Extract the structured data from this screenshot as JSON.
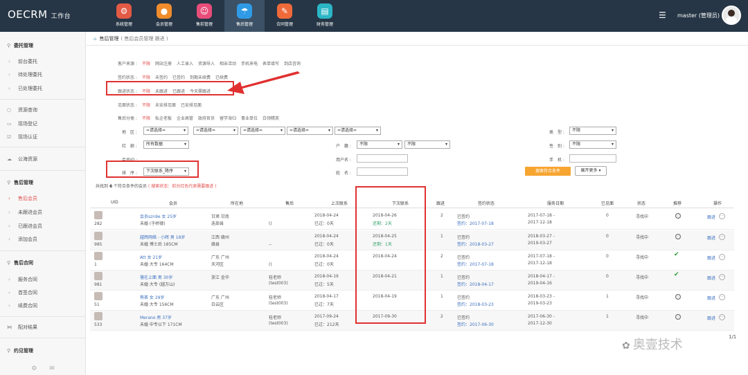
{
  "app": {
    "logo": "OECRM",
    "logo_sub": "工作台",
    "user": "master (管理员)",
    "menu_icon": "hamburger-icon"
  },
  "modules": [
    {
      "label": "系统管理",
      "icon": "gear-icon",
      "color": "#e35a45"
    },
    {
      "label": "会员管理",
      "icon": "user-icon",
      "color": "#f08c2c"
    },
    {
      "label": "售前管理",
      "icon": "face-icon",
      "color": "#e84d7a"
    },
    {
      "label": "售后管理",
      "icon": "umbrella-icon",
      "color": "#2f9be6"
    },
    {
      "label": "合同管理",
      "icon": "edit-icon",
      "color": "#ef6a3a"
    },
    {
      "label": "财务管理",
      "icon": "chart-icon",
      "color": "#2bb6c6"
    }
  ],
  "sidebar": {
    "g1": "委托管理",
    "g1_items": [
      "前台委托",
      "待处理委托",
      "已处理委托"
    ],
    "plain": [
      "资源查询",
      "现场登记",
      "现场认证",
      "公海资源"
    ],
    "g2": "售后管理",
    "g2_items": [
      "售后会员",
      "未跟进会员",
      "已跟进会员",
      "添加会员"
    ],
    "g3": "售后合同",
    "g3_items": [
      "服务合同",
      "首签合同",
      "续费合同"
    ],
    "plain2": "配对结果",
    "g4": "约见管理"
  },
  "breadcrumb": {
    "title": "售后管理",
    "sub": "( 售后会员管理 跟进 )"
  },
  "filters": [
    {
      "label": "客户来源 :",
      "opts": [
        "不限",
        "网站注册",
        "人工录入",
        "资源导入",
        "相亲活动",
        "手机来电",
        "表单填写",
        "到店咨询"
      ]
    },
    {
      "label": "签约状态 :",
      "opts": [
        "不限",
        "未签约",
        "已签约",
        "到期未续费",
        "已续费"
      ]
    },
    {
      "label": "跟进状态 :",
      "opts": [
        "不限",
        "未跟进",
        "已跟进",
        "今天需跟进"
      ]
    },
    {
      "label": "见面状态 :",
      "opts": [
        "不限",
        "未安排见面",
        "已安排见面"
      ]
    },
    {
      "label": "售后分类 :",
      "opts": [
        "不限",
        "私企老板",
        "企业高管",
        "政府官员",
        "留学海归",
        "事业单位",
        "白领精英"
      ]
    }
  ],
  "form": {
    "area": "地　区 :",
    "area_sel": [
      "=请选择=",
      "=请选择=",
      "=请选择=",
      "=请选择=",
      "=请选择="
    ],
    "type": "类　型 :",
    "type_val": "不限",
    "matchmaker": "红　娘 :",
    "matchmaker_val": "所有数据",
    "hukou": "户　籍 :",
    "hukou_val1": "不限",
    "hukou_val2": "不限",
    "gender": "性　别 :",
    "gender_val": "不限",
    "member_no": "会员ID :",
    "username": "用户名 :",
    "phone": "手　机 :",
    "sort": "排　序 :",
    "sort_val": "下次联系_降序",
    "name": "姓　名 :",
    "search_btn": "搜索符合条件",
    "more_btn": "展开更多 ▾"
  },
  "found": {
    "prefix": "共找到",
    "count": "6",
    "suffix": "个符合条件的会员",
    "note": "( 搜索状态：前台红色代表需要跟进 )"
  },
  "columns": [
    "UID",
    "会员",
    "所在地",
    "售后",
    "上次联系",
    "下次联系",
    "跟进",
    "签约状态",
    "服务日期",
    "已见面",
    "状态",
    "推荐",
    "操作"
  ],
  "rows": [
    {
      "uid": "282",
      "m1": "会员szn9e 女 25岁",
      "m2": "未婚 (于桥德)",
      "loc1": "甘肃 甘南",
      "loc2": "迭部县",
      "after": "()",
      "last1": "2018-04-24",
      "last2": "已过：0天",
      "next1": "2018-04-26",
      "next2": "还剩：2天",
      "follow": "2",
      "sign1": "已签约",
      "sign2": "签约：2017-07-18",
      "d1": "2017-07-18 -",
      "d2": "2017-12-18",
      "met": "0",
      "status": "寻找中",
      "rec": "dot",
      "op": "跟进"
    },
    {
      "uid": "985",
      "m1": "越辉网络 - 小辉 男 18岁",
      "m2": "未婚 博士后 185CM",
      "loc1": "江西 赣州",
      "loc2": "赣县",
      "after": "--",
      "last1": "2018-04-24",
      "last2": "已过：0天",
      "next1": "2018-04-25",
      "next2": "还剩：1天",
      "follow": "1",
      "sign1": "已签约",
      "sign2": "签约：2018-03-27",
      "d1": "2018-03-27 -",
      "d2": "2019-03-27",
      "met": "0",
      "status": "寻找中",
      "rec": "dot",
      "op": "跟进"
    },
    {
      "uid": "1",
      "m1": "Att 女 21岁",
      "m2": "未婚 大专 164CM",
      "loc1": "广东 广州",
      "loc2": "天河区",
      "after": "()",
      "last1": "2018-04-24",
      "last2": "已过：0天",
      "next1": "2018-04-24",
      "next2": "",
      "follow": "2",
      "sign1": "已签约",
      "sign2": "签约：2017-07-18",
      "d1": "2017-07-18 -",
      "d2": "2017-12-18",
      "met": "0",
      "status": "寻找中",
      "rec": "check",
      "op": "跟进"
    },
    {
      "uid": "981",
      "m1": "落在上面 男 30岁",
      "m2": "未婚 大专 (越万山)",
      "loc1": "浙江 金华",
      "loc2": "",
      "after1": "桂老师",
      "after": "(test003)",
      "last1": "2018-04-19",
      "last2": "已过：5天",
      "next1": "2018-04-21",
      "next2": "",
      "follow": "1",
      "sign1": "已签约",
      "sign2": "签约：2018-04-17",
      "d1": "2018-04-17 -",
      "d2": "2019-04-16",
      "met": "0",
      "status": "寻找中",
      "rec": "check",
      "op": "跟进"
    },
    {
      "uid": "51",
      "m1": "熊茶 女 29岁",
      "m2": "未婚 大专 156CM",
      "loc1": "广东 广州",
      "loc2": "白云区",
      "after1": "桂老师",
      "after": "(test003)",
      "last1": "2018-04-17",
      "last2": "已过：7天",
      "next1": "2018-04-19",
      "next2": "",
      "follow": "1",
      "sign1": "已签约",
      "sign2": "签约：2018-03-23",
      "d1": "2018-03-23 -",
      "d2": "2019-03-23",
      "met": "1",
      "status": "寻找中",
      "rec": "dot",
      "op": "跟进"
    },
    {
      "uid": "533",
      "m1": "Merano 男 37岁",
      "m2": "未婚 中专以下 171CM",
      "loc1": "",
      "loc2": "",
      "after1": "桂老师",
      "after": "(test003)",
      "last1": "2017-09-24",
      "last2": "已过：212天",
      "next1": "2017-09-30",
      "next2": "",
      "follow": "2",
      "sign1": "已签约",
      "sign2": "签约：2017-06-30",
      "d1": "2017-06-30 -",
      "d2": "2017-12-30",
      "met": "1",
      "status": "寻找中",
      "rec": "dot",
      "op": "跟进"
    }
  ],
  "pager": "1/1",
  "watermark": "奥壹技术"
}
